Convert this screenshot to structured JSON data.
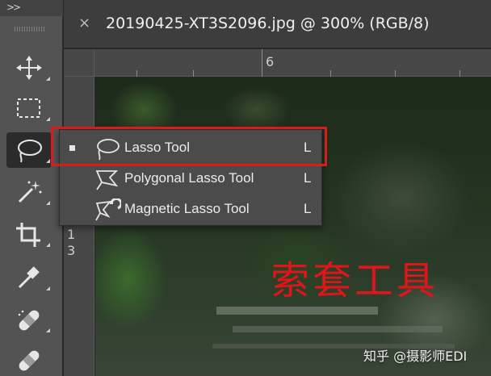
{
  "toolbar": {
    "collapse_label": ">>",
    "tools": [
      {
        "name": "move-tool",
        "icon": "move-arrows-icon"
      },
      {
        "name": "marquee-tool",
        "icon": "rectangle-marquee-icon"
      },
      {
        "name": "lasso-tool",
        "icon": "lasso-icon",
        "active": true
      },
      {
        "name": "magic-wand-tool",
        "icon": "magic-wand-icon"
      },
      {
        "name": "crop-tool",
        "icon": "crop-icon"
      },
      {
        "name": "eyedropper-tool",
        "icon": "eyedropper-icon"
      },
      {
        "name": "spot-healing-tool",
        "icon": "bandage-icon"
      },
      {
        "name": "healing-brush-tool",
        "icon": "bandage-icon"
      }
    ]
  },
  "document": {
    "close_glyph": "×",
    "title": "20190425-XT3S2096.jpg @ 300% (RGB/8)"
  },
  "rulers": {
    "top_label": "6",
    "left_label_1": "1",
    "left_label_2": "3"
  },
  "flyout": {
    "items": [
      {
        "label": "Lasso Tool",
        "shortcut": "L",
        "selected": true,
        "icon": "lasso-icon"
      },
      {
        "label": "Polygonal Lasso Tool",
        "shortcut": "L",
        "selected": false,
        "icon": "polygonal-lasso-icon"
      },
      {
        "label": "Magnetic Lasso Tool",
        "shortcut": "L",
        "selected": false,
        "icon": "magnetic-lasso-icon"
      }
    ]
  },
  "annotation": {
    "text": "索套工具",
    "color": "#e0141b"
  },
  "watermark": {
    "text": "知乎 @摄影师EDI"
  },
  "colors": {
    "highlight_border": "#d41d1d",
    "panel_bg": "#535353",
    "menu_bg": "#4b4b4b"
  }
}
